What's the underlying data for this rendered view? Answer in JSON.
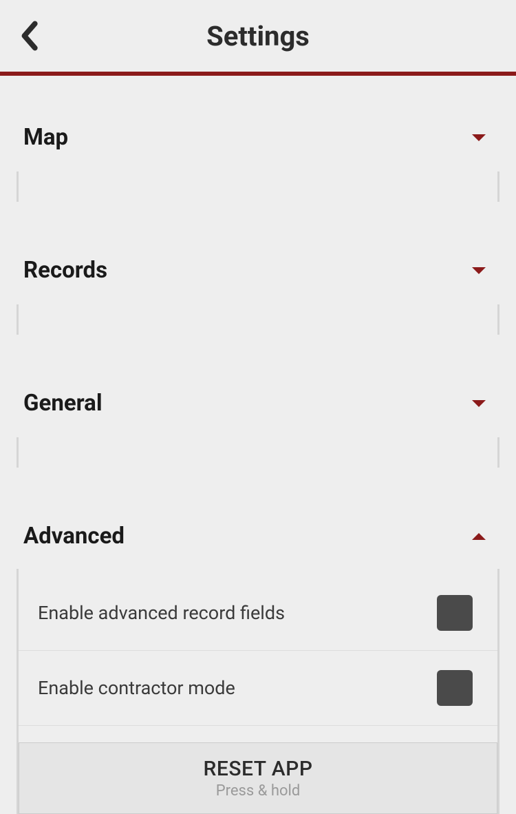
{
  "header": {
    "title": "Settings"
  },
  "sections": {
    "map": {
      "title": "Map",
      "expanded": false
    },
    "records": {
      "title": "Records",
      "expanded": false
    },
    "general": {
      "title": "General",
      "expanded": false
    },
    "advanced": {
      "title": "Advanced",
      "expanded": true,
      "settings": {
        "enable_advanced_record_fields": {
          "label": "Enable advanced record fields",
          "value": false
        },
        "enable_contractor_mode": {
          "label": "Enable contractor mode",
          "value": false
        }
      },
      "reset": {
        "label": "RESET APP",
        "hint": "Press & hold"
      }
    }
  }
}
